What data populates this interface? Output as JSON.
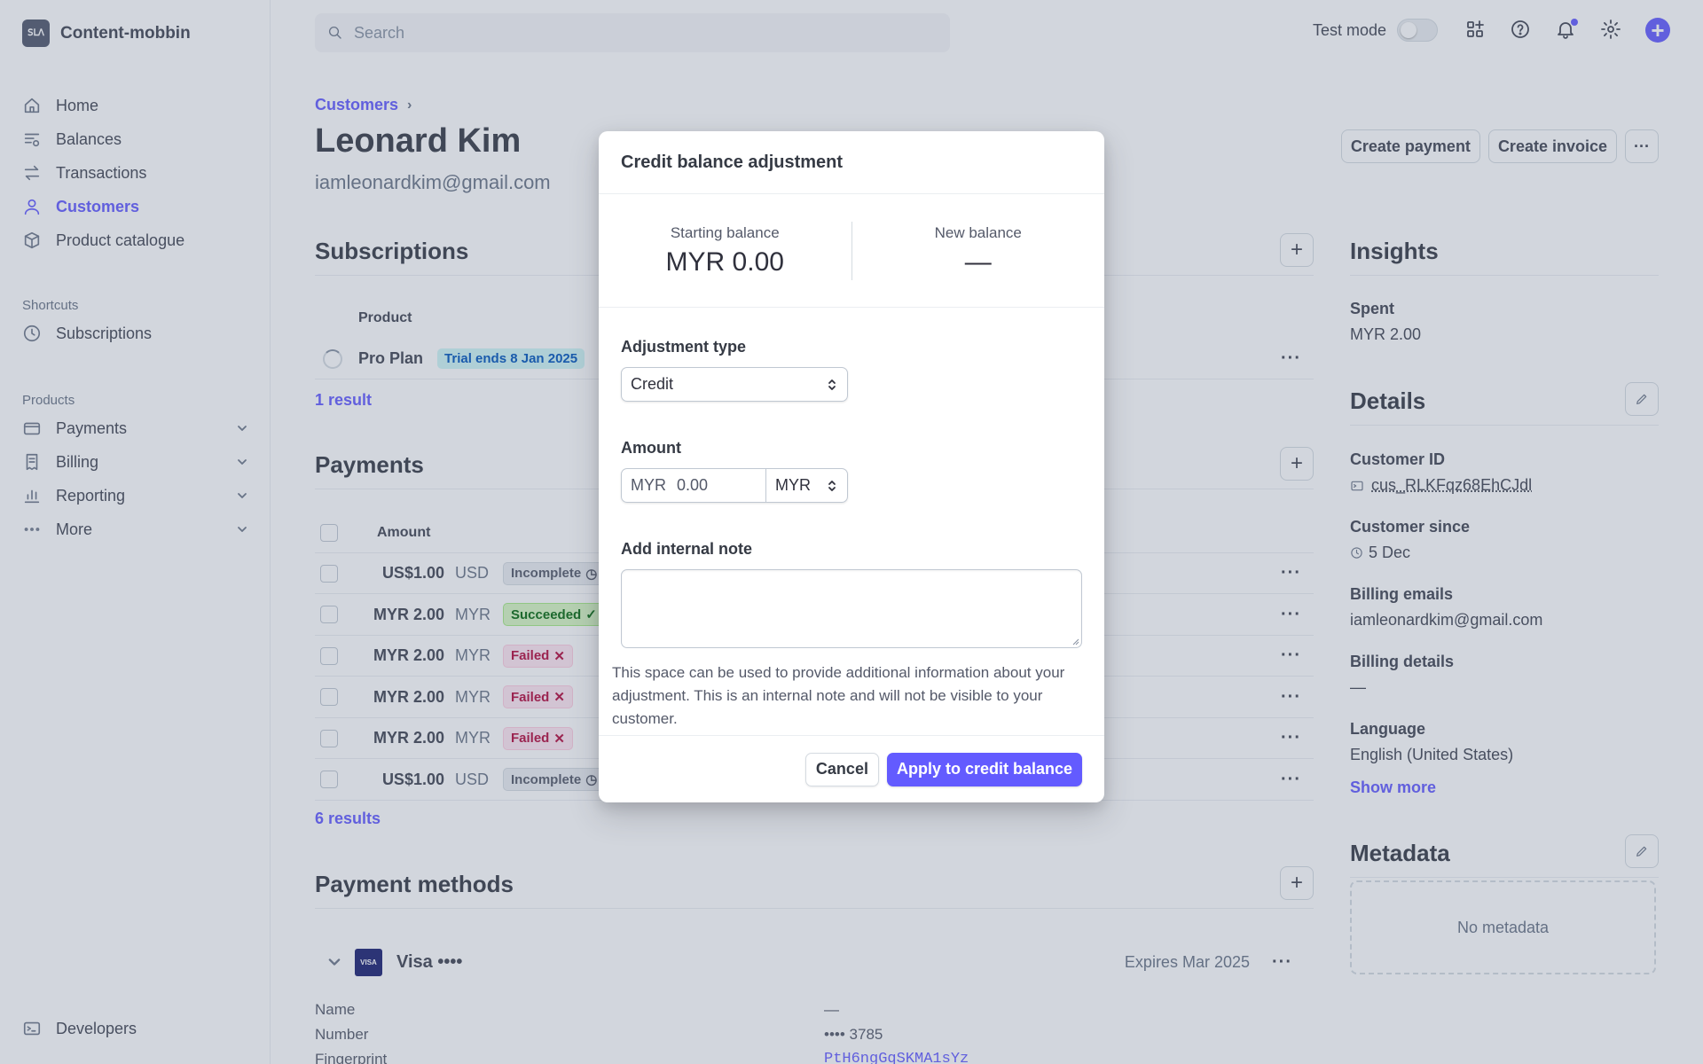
{
  "app": {
    "name": "Content-mobbin",
    "logo_text": "ꓢꓡꓥ"
  },
  "sidebar": {
    "nav": [
      {
        "label": "Home",
        "icon": "home-icon"
      },
      {
        "label": "Balances",
        "icon": "balances-icon"
      },
      {
        "label": "Transactions",
        "icon": "transactions-icon"
      },
      {
        "label": "Customers",
        "icon": "customers-icon",
        "active": true
      },
      {
        "label": "Product catalogue",
        "icon": "product-icon"
      }
    ],
    "shortcuts_heading": "Shortcuts",
    "shortcuts": [
      {
        "label": "Subscriptions",
        "icon": "clock-icon"
      }
    ],
    "products_heading": "Products",
    "products": [
      {
        "label": "Payments",
        "icon": "payments-icon"
      },
      {
        "label": "Billing",
        "icon": "billing-icon"
      },
      {
        "label": "Reporting",
        "icon": "reporting-icon"
      },
      {
        "label": "More",
        "icon": "more-icon"
      }
    ],
    "developers": "Developers"
  },
  "topbar": {
    "search_placeholder": "Search",
    "test_mode": "Test mode"
  },
  "customer": {
    "breadcrumb": "Customers",
    "name": "Leonard Kim",
    "email": "iamleonardkim@gmail.com"
  },
  "header_buttons": {
    "create_payment": "Create payment",
    "create_invoice": "Create invoice",
    "more": "···"
  },
  "subscriptions": {
    "title": "Subscriptions",
    "col_product": "Product",
    "row": {
      "product": "Pro Plan",
      "badge": "Trial ends 8 Jan 2025"
    },
    "results": "1 result"
  },
  "payments": {
    "title": "Payments",
    "col_amount": "Amount",
    "rows": [
      {
        "amount": "US$1.00",
        "currency": "USD",
        "status": "Incomplete",
        "kind": "inc"
      },
      {
        "amount": "MYR 2.00",
        "currency": "MYR",
        "status": "Succeeded",
        "kind": "suc"
      },
      {
        "amount": "MYR 2.00",
        "currency": "MYR",
        "status": "Failed",
        "kind": "fail"
      },
      {
        "amount": "MYR 2.00",
        "currency": "MYR",
        "status": "Failed",
        "kind": "fail"
      },
      {
        "amount": "MYR 2.00",
        "currency": "MYR",
        "status": "Failed",
        "kind": "fail"
      },
      {
        "amount": "US$1.00",
        "currency": "USD",
        "status": "Incomplete",
        "kind": "inc"
      }
    ],
    "results": "6 results"
  },
  "payment_methods": {
    "title": "Payment methods",
    "card_brand": "VISA",
    "card_label": "Visa ••••",
    "expires": "Expires Mar 2025",
    "fields": [
      {
        "label": "Name",
        "value": "—"
      },
      {
        "label": "Number",
        "value": "•••• 3785"
      },
      {
        "label": "Fingerprint",
        "value": "PtH6ngGqSKMA1sYz"
      }
    ]
  },
  "insights": {
    "title": "Insights",
    "spent_label": "Spent",
    "spent_value": "MYR 2.00"
  },
  "details": {
    "title": "Details",
    "customer_id_label": "Customer ID",
    "customer_id": "cus_RLKFqz68EhCJdl",
    "since_label": "Customer since",
    "since": "5 Dec",
    "billing_emails_label": "Billing emails",
    "billing_emails": "iamleonardkim@gmail.com",
    "billing_details_label": "Billing details",
    "billing_details": "—",
    "language_label": "Language",
    "language": "English (United States)",
    "show_more": "Show more"
  },
  "metadata": {
    "title": "Metadata",
    "empty": "No metadata"
  },
  "modal": {
    "title": "Credit balance adjustment",
    "starting_label": "Starting balance",
    "starting_value": "MYR 0.00",
    "new_label": "New balance",
    "new_value": "—",
    "adjustment_type_label": "Adjustment type",
    "adjustment_type_value": "Credit",
    "amount_label": "Amount",
    "amount_prefix": "MYR",
    "amount_value": "0.00",
    "amount_currency": "MYR",
    "note_label": "Add internal note",
    "note_help": "This space can be used to provide additional information about your adjustment. This is an internal note and will not be visible to your customer.",
    "cancel": "Cancel",
    "apply": "Apply to credit balance"
  },
  "colors": {
    "accent": "#635bff",
    "overlay": "rgba(94,108,132,0.28)"
  }
}
